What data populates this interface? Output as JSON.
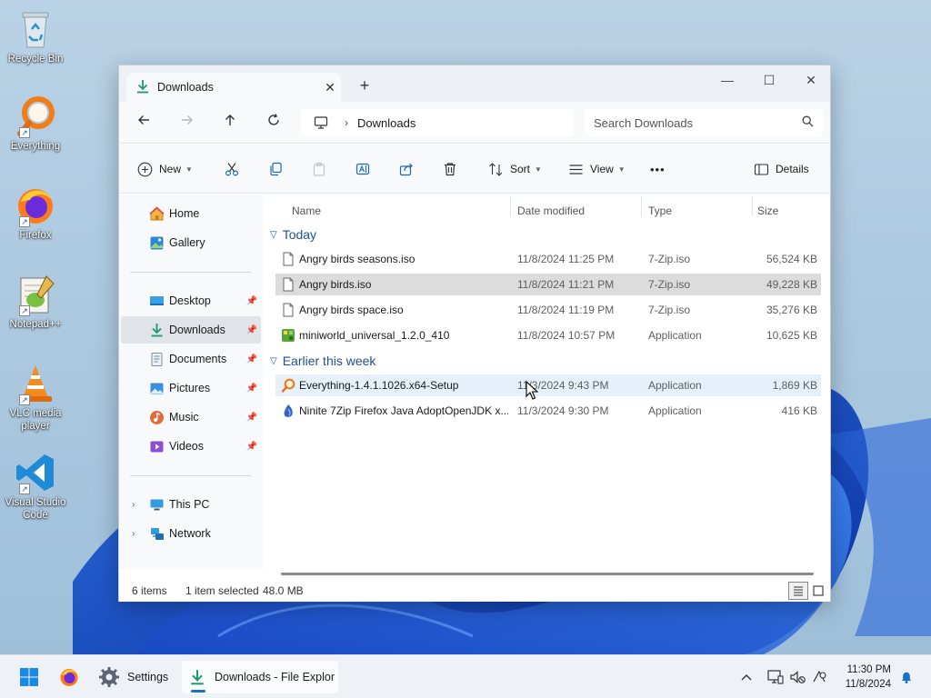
{
  "desktop": {
    "icons": [
      {
        "label": "Recycle Bin"
      },
      {
        "label": "Everything"
      },
      {
        "label": "Firefox"
      },
      {
        "label": "Notepad++"
      },
      {
        "label": "VLC media player"
      },
      {
        "label": "Visual Studio Code"
      }
    ]
  },
  "window": {
    "tab_title": "Downloads",
    "tab_close": "✕",
    "new_tab": "+",
    "controls": {
      "minimize": "—",
      "maximize": "☐",
      "close": "✕"
    },
    "address": {
      "root_icon": "this-pc-icon",
      "separator": "›",
      "current": "Downloads"
    },
    "search_placeholder": "Search Downloads",
    "toolbar": {
      "new_label": "New",
      "sort_label": "Sort",
      "view_label": "View",
      "more_label": "•••",
      "details_label": "Details"
    },
    "nav": {
      "quick": [
        {
          "label": "Home"
        },
        {
          "label": "Gallery"
        }
      ],
      "pinned": [
        {
          "label": "Desktop"
        },
        {
          "label": "Downloads"
        },
        {
          "label": "Documents"
        },
        {
          "label": "Pictures"
        },
        {
          "label": "Music"
        },
        {
          "label": "Videos"
        }
      ],
      "tree": [
        {
          "label": "This PC"
        },
        {
          "label": "Network"
        }
      ],
      "selected": "Downloads"
    },
    "columns": {
      "name": "Name",
      "date": "Date modified",
      "type": "Type",
      "size": "Size"
    },
    "groups": [
      {
        "label": "Today",
        "files": [
          {
            "name": "Angry birds seasons.iso",
            "date": "11/8/2024 11:25 PM",
            "type": "7-Zip.iso",
            "size": "56,524 KB",
            "icon": "iso-file-icon"
          },
          {
            "name": "Angry birds.iso",
            "date": "11/8/2024 11:21 PM",
            "type": "7-Zip.iso",
            "size": "49,228 KB",
            "icon": "iso-file-icon",
            "selected": true
          },
          {
            "name": "Angry birds space.iso",
            "date": "11/8/2024 11:19 PM",
            "type": "7-Zip.iso",
            "size": "35,276 KB",
            "icon": "iso-file-icon"
          },
          {
            "name": "miniworld_universal_1.2.0_410",
            "date": "11/8/2024 10:57 PM",
            "type": "Application",
            "size": "10,625 KB",
            "icon": "miniworld-app-icon"
          }
        ]
      },
      {
        "label": "Earlier this week",
        "files": [
          {
            "name": "Everything-1.4.1.1026.x64-Setup",
            "date": "11/3/2024 9:43 PM",
            "type": "Application",
            "size": "1,869 KB",
            "icon": "everything-app-icon",
            "hover": true
          },
          {
            "name": "Ninite 7Zip Firefox Java AdoptOpenJDK x...",
            "date": "11/3/2024 9:30 PM",
            "type": "Application",
            "size": "416 KB",
            "icon": "ninite-app-icon"
          }
        ]
      }
    ],
    "status": {
      "count": "6 items",
      "selection": "1 item selected",
      "selection_size": "48.0 MB"
    }
  },
  "taskbar": {
    "settings_label": "Settings",
    "explorer_label": "Downloads - File Explor",
    "time": "11:30 PM",
    "date": "11/8/2024"
  },
  "colors": {
    "accent": "#1673c9",
    "selected_row": "#dcdcdc",
    "hover_row": "#e6f0fa",
    "group_header": "#1f4f8f"
  }
}
